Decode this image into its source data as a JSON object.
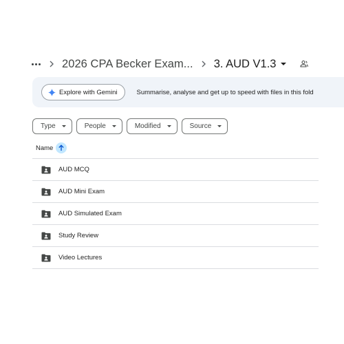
{
  "breadcrumb": {
    "more_icon": "more-horizontal-icon",
    "separator_icon": "chevron-right-icon",
    "parent": "2026 CPA Becker Exam...",
    "current": "3. AUD V1.3",
    "current_dropdown_icon": "caret-down-icon",
    "share_icon": "shared-folder-people-icon"
  },
  "gemini": {
    "button_label": "Explore with Gemini",
    "button_icon": "gemini-sparkle-icon",
    "description": "Summarise, analyse and get up to speed with files in this fold",
    "accent_color": "#4285f4",
    "banner_bg": "#f0f4f9"
  },
  "filters": [
    {
      "label": "Type"
    },
    {
      "label": "People"
    },
    {
      "label": "Modified"
    },
    {
      "label": "Source"
    }
  ],
  "columns": {
    "name": "Name",
    "sort_icon": "arrow-up-icon",
    "sort_direction": "ascending"
  },
  "files": [
    {
      "name": "AUD MCQ",
      "icon": "shared-folder-icon"
    },
    {
      "name": "AUD Mini Exam",
      "icon": "shared-folder-icon"
    },
    {
      "name": "AUD Simulated Exam",
      "icon": "shared-folder-icon"
    },
    {
      "name": "Study Review",
      "icon": "shared-folder-icon"
    },
    {
      "name": "Video Lectures",
      "icon": "shared-folder-icon"
    }
  ]
}
